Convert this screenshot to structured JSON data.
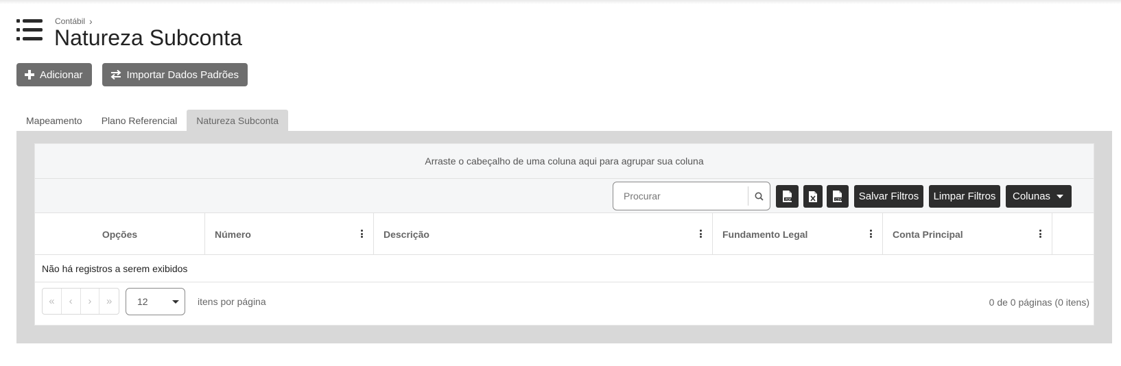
{
  "breadcrumb": {
    "parent": "Contábil"
  },
  "page": {
    "title": "Natureza Subconta"
  },
  "actions": {
    "add_label": "Adicionar",
    "import_label": "Importar Dados Padrões"
  },
  "tabs": [
    {
      "label": "Mapeamento",
      "active": false
    },
    {
      "label": "Plano Referencial",
      "active": false
    },
    {
      "label": "Natureza Subconta",
      "active": true
    }
  ],
  "grid": {
    "group_hint": "Arraste o cabeçalho de uma coluna aqui para agrupar sua coluna",
    "search_placeholder": "Procurar",
    "search_value": "",
    "export_icons": [
      "pdf-file-icon",
      "excel-file-icon",
      "csv-file-icon"
    ],
    "save_filters_label": "Salvar Filtros",
    "clear_filters_label": "Limpar Filtros",
    "columns_label": "Colunas",
    "columns": [
      "Opções",
      "Número",
      "Descrição",
      "Fundamento Legal",
      "Conta Principal"
    ],
    "empty_message": "Não há registros a serem exibidos",
    "pager": {
      "page_size": "12",
      "per_page_label": "itens por página",
      "info": "0 de 0 páginas (0 itens)"
    }
  },
  "colors": {
    "button_gray": "#6e6e6e",
    "button_dark": "#2d2d2d",
    "panel_bg": "#d8d8d8",
    "toolbar_bg": "#f5f6f7"
  }
}
